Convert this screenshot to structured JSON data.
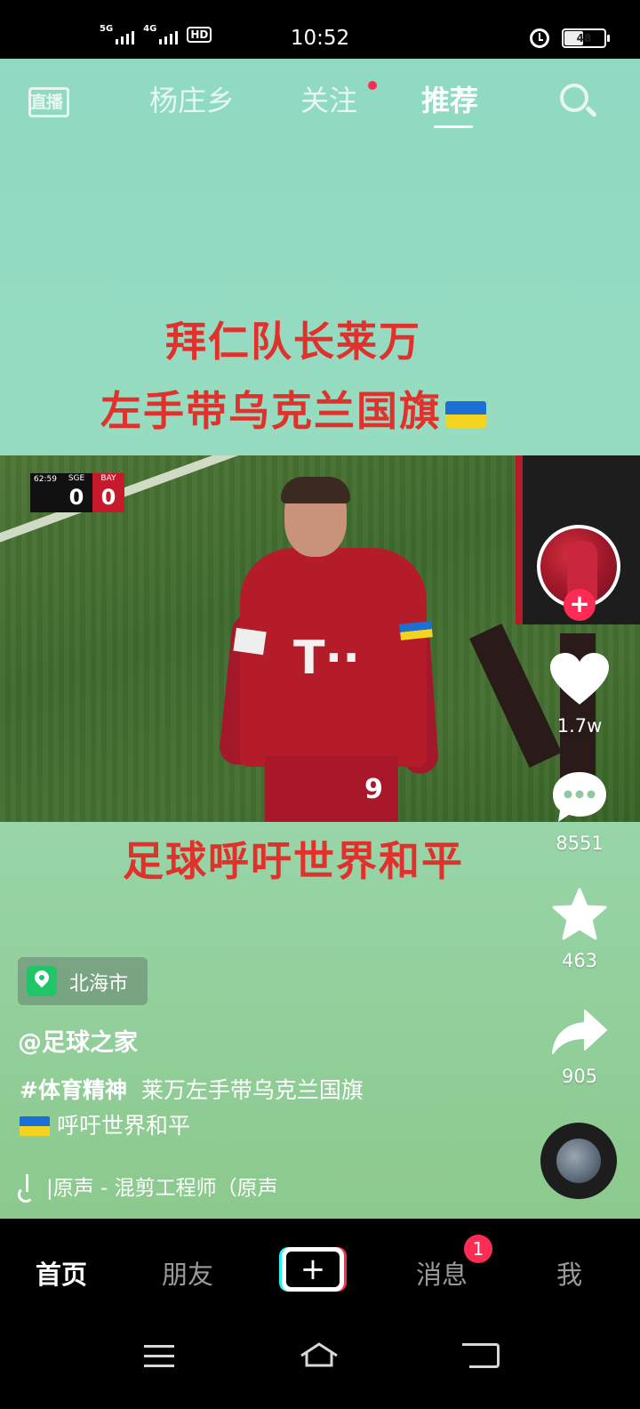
{
  "status_bar": {
    "net1": "5G",
    "net2": "4G",
    "hd": "HD",
    "time": "10:52",
    "battery": "48"
  },
  "top_nav": {
    "live_icon_text": "直播",
    "tabs": [
      "杨庄乡",
      "关注",
      "推荐"
    ],
    "active_tab": "推荐"
  },
  "video": {
    "caption_line1": "拜仁队长莱万",
    "caption_line2": "左手带乌克兰国旗",
    "caption_bottom": "足球呼吁世界和平",
    "scoreboard": {
      "clock": "62:59",
      "home": "SGE",
      "home_score": "0",
      "away": "BAY",
      "away_score": "0"
    }
  },
  "actions": {
    "likes": "1.7w",
    "comments": "8551",
    "favorites": "463",
    "shares": "905"
  },
  "info": {
    "location": "北海市",
    "author": "@足球之家",
    "hashtag": "#体育精神",
    "desc_line1": "莱万左手带乌克兰国旗",
    "desc_line2": "呼吁世界和平",
    "music": "|原声 - 混剪工程师（原声"
  },
  "tab_bar": {
    "home": "首页",
    "friends": "朋友",
    "create": "+",
    "messages": "消息",
    "messages_badge": "1",
    "me": "我"
  },
  "colors": {
    "accent": "#fe2c55",
    "caption": "#e0312c",
    "teal": "#25f4ee"
  }
}
